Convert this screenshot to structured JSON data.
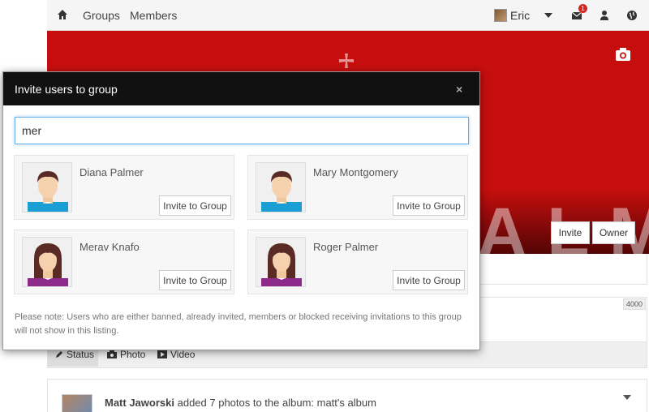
{
  "nav": {
    "home_icon": "home-icon",
    "links": [
      "Groups",
      "Members"
    ],
    "user_name": "Eric",
    "mail_badge": "1",
    "icons": [
      "envelope-icon",
      "user-icon",
      "globe-icon"
    ]
  },
  "cover": {
    "color": "#c70e0e",
    "camera_icon": "camera-icon",
    "invite_label": "Invite",
    "owner_label": "Owner"
  },
  "composer": {
    "counter": "4000",
    "tabs": [
      "Status",
      "Photo",
      "Video"
    ]
  },
  "post": {
    "author": "Matt Jaworski",
    "text": "added 7 photos to the album: matt's album"
  },
  "modal": {
    "title": "Invite users to group",
    "close": "×",
    "search_value": "mer",
    "users": [
      {
        "name": "Diana Palmer",
        "button": "Invite to Group",
        "avatar": "male"
      },
      {
        "name": "Mary Montgomery",
        "button": "Invite to Group",
        "avatar": "male"
      },
      {
        "name": "Merav Knafo",
        "button": "Invite to Group",
        "avatar": "female"
      },
      {
        "name": "Roger Palmer",
        "button": "Invite to Group",
        "avatar": "female"
      }
    ],
    "note": "Please note: Users who are either banned, already invited, members or blocked receiving invitations to this group will not show in this listing."
  }
}
